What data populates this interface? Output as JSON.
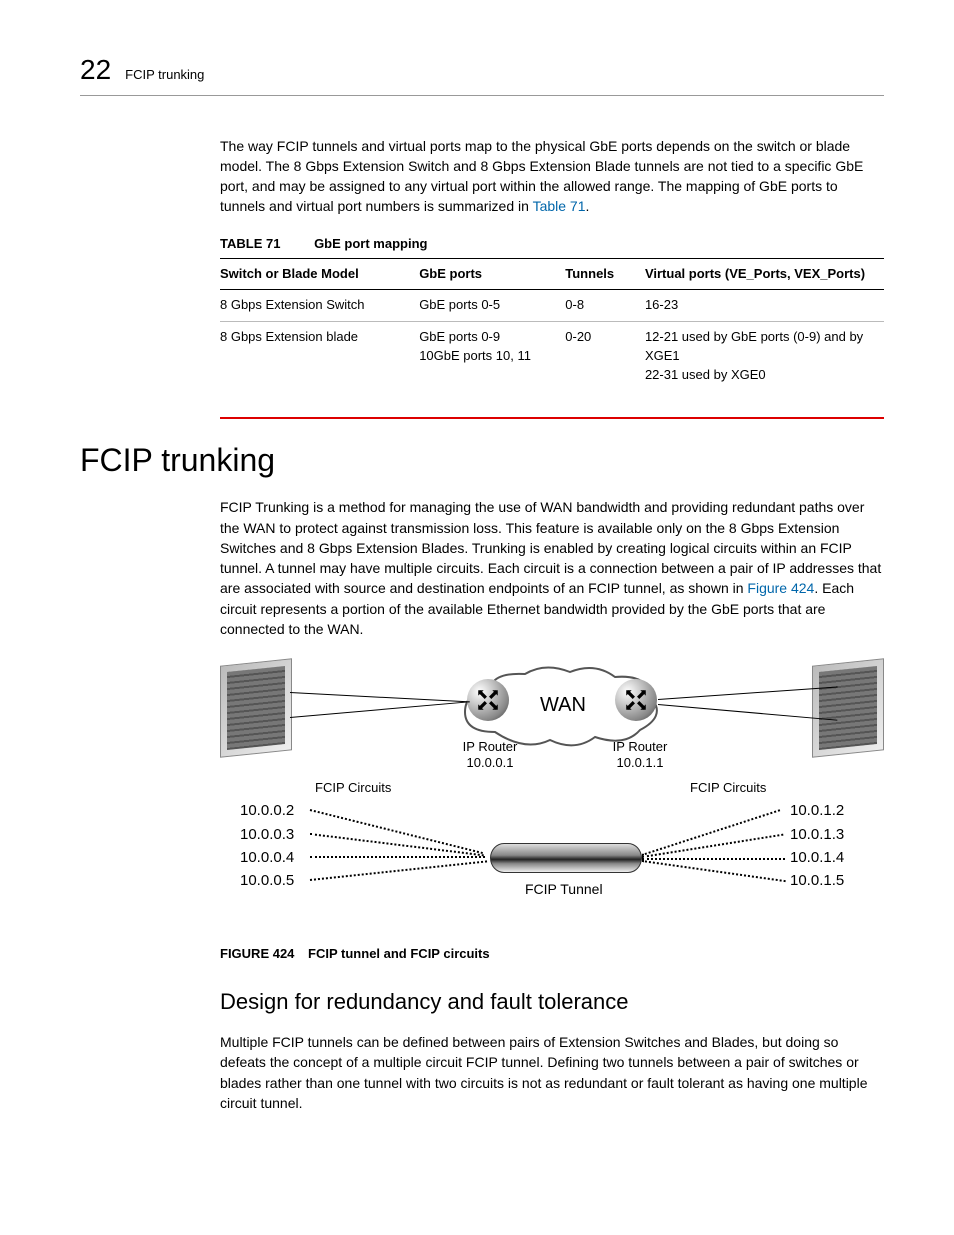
{
  "header": {
    "chapter_number": "22",
    "chapter_title": "FCIP trunking"
  },
  "intro_para": {
    "text_before_link": "The way FCIP tunnels and virtual ports map to the physical GbE ports depends on the switch or blade model. The 8 Gbps Extension Switch and 8 Gbps Extension Blade tunnels are not tied to a specific GbE port, and may be assigned to any virtual port within the allowed range. The mapping of GbE ports to tunnels and virtual port numbers is summarized in ",
    "link": "Table 71",
    "text_after_link": "."
  },
  "table71": {
    "label": "TABLE 71",
    "title": "GbE port mapping",
    "headers": [
      "Switch or Blade Model",
      "GbE ports",
      "Tunnels",
      "Virtual ports (VE_Ports, VEX_Ports)"
    ],
    "rows": [
      {
        "model": "8 Gbps Extension Switch",
        "gbe": "GbE ports 0-5",
        "tunnels": "0-8",
        "vports": "16-23"
      },
      {
        "model": "8 Gbps Extension blade",
        "gbe": "GbE ports 0-9\n10GbE ports 10, 11",
        "tunnels": "0-20",
        "vports": "12-21 used by GbE ports (0-9) and by XGE1\n22-31 used by XGE0"
      }
    ]
  },
  "section": {
    "title": "FCIP trunking",
    "para_before_link": "FCIP Trunking is a method for managing the use of WAN bandwidth and providing redundant paths over the WAN to protect against transmission loss. This feature is available only on the 8 Gbps Extension Switches and 8 Gbps Extension Blades. Trunking is enabled by creating logical circuits within an FCIP tunnel. A tunnel may have multiple circuits. Each circuit is a connection between a pair of IP addresses that are associated with source and destination endpoints of an FCIP tunnel, as shown in ",
    "link": "Figure 424",
    "para_after_link": ". Each circuit represents a portion of the available Ethernet bandwidth provided by the GbE ports that are connected to the WAN."
  },
  "figure": {
    "wan": "WAN",
    "left_router_label": "IP Router",
    "left_router_ip": "10.0.0.1",
    "right_router_label": "IP Router",
    "right_router_ip": "10.0.1.1",
    "circuits_left": "FCIP Circuits",
    "circuits_right": "FCIP Circuits",
    "left_ips": [
      "10.0.0.2",
      "10.0.0.3",
      "10.0.0.4",
      "10.0.0.5"
    ],
    "right_ips": [
      "10.0.1.2",
      "10.0.1.3",
      "10.0.1.4",
      "10.0.1.5"
    ],
    "tunnel_label": "FCIP Tunnel",
    "caption_label": "FIGURE 424",
    "caption_title": "FCIP tunnel and FCIP circuits"
  },
  "subsection": {
    "title": "Design for redundancy and fault tolerance",
    "para": "Multiple FCIP tunnels can be defined between pairs of Extension Switches and Blades, but doing so defeats the concept of a multiple circuit FCIP tunnel. Defining two tunnels between a pair of switches or blades rather than one tunnel with two circuits is not as redundant or fault tolerant as having one multiple circuit tunnel."
  }
}
